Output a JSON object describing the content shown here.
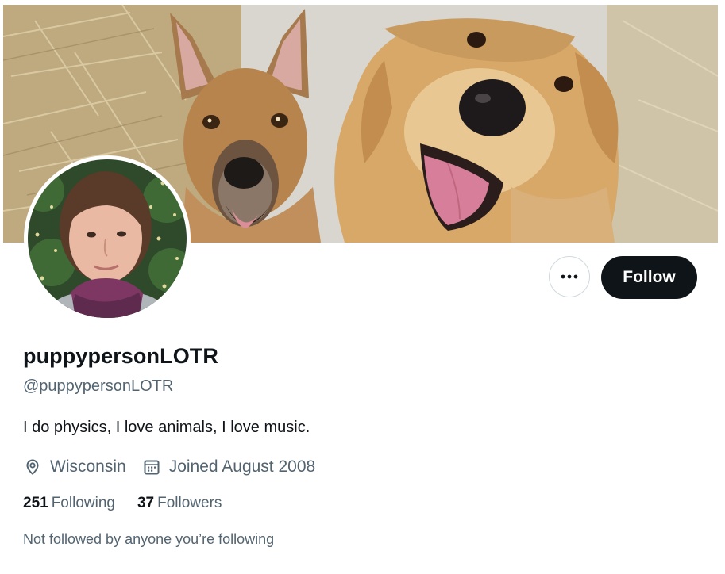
{
  "profile": {
    "display_name": "puppypersonLOTR",
    "handle": "@puppypersonLOTR",
    "bio": "I do physics, I love animals, I love music.",
    "location": "Wisconsin",
    "joined": "Joined August 2008",
    "following_count": "251",
    "following_label": "Following",
    "followers_count": "37",
    "followers_label": "Followers",
    "followed_notice": "Not followed by anyone you’re following"
  },
  "actions": {
    "follow_label": "Follow",
    "more_icon": "more-horizontal-icon"
  },
  "icons": {
    "location": "location-pin-icon",
    "joined": "calendar-icon"
  },
  "colors": {
    "primary_text": "#0f1419",
    "secondary_text": "#536471",
    "follow_button_bg": "#0f1419",
    "border": "#cfd9de"
  }
}
